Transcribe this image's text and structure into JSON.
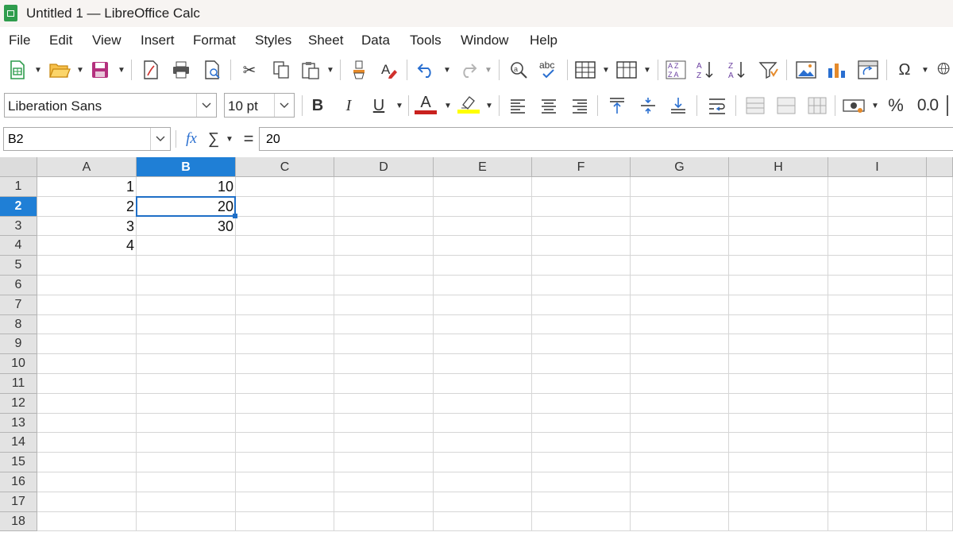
{
  "window": {
    "title": "Untitled 1 — LibreOffice Calc",
    "app_icon": "calc-icon"
  },
  "menu": [
    "File",
    "Edit",
    "View",
    "Insert",
    "Format",
    "Styles",
    "Sheet",
    "Data",
    "Tools",
    "Window",
    "Help"
  ],
  "formatting": {
    "font_name": "Liberation Sans",
    "font_size": "10 pt",
    "percent_symbol": "%",
    "decimal_symbol": "0.0"
  },
  "formula_bar": {
    "cell_reference": "B2",
    "content": "20",
    "fx_label": "fx",
    "sum_symbol": "∑",
    "equals_symbol": "="
  },
  "colors": {
    "accent": "#1f7fd6",
    "font_color_bar": "#c9211e",
    "highlight_bar": "#ffff00"
  },
  "columns": [
    "A",
    "B",
    "C",
    "D",
    "E",
    "F",
    "G",
    "H",
    "I"
  ],
  "rows": [
    "1",
    "2",
    "3",
    "4",
    "5",
    "6",
    "7",
    "8",
    "9",
    "10",
    "11",
    "12",
    "13",
    "14",
    "15",
    "16",
    "17",
    "18"
  ],
  "selected": {
    "column": "B",
    "row": "2"
  },
  "cells": {
    "A1": "1",
    "B1": "10",
    "A2": "2",
    "B2": "20",
    "A3": "3",
    "B3": "30",
    "A4": "4"
  }
}
